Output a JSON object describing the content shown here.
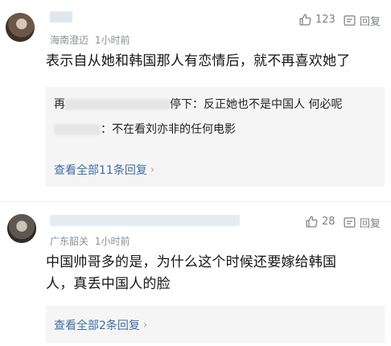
{
  "comments": [
    {
      "location": "海南澄迈",
      "time": "1小时前",
      "likes": "123",
      "reply_label": "回复",
      "content": "表示自从她和韩国那人有恋情后，就不再喜欢她了",
      "replies": [
        {
          "prefix": "再",
          "suffix": "停下：反正她也不是中国人 何必呢"
        },
        {
          "prefix": "",
          "suffix": "：不在看刘亦非的任何电影"
        }
      ],
      "view_all": "查看全部11条回复"
    },
    {
      "location": "广东韶关",
      "time": "1小时前",
      "likes": "28",
      "reply_label": "回复",
      "content_line1": "中国帅哥多的是，为什么这个时候还要嫁给韩国",
      "content_line2": "人，真丢中国人的脸",
      "view_all": "查看全部2条回复"
    }
  ],
  "colors": {
    "link": "#3f6ea5",
    "meta": "#8b8f94",
    "reply_bg": "#f5f5f5"
  },
  "icons": [
    "thumbs-up-icon",
    "reply-icon",
    "chevron-right-icon"
  ]
}
